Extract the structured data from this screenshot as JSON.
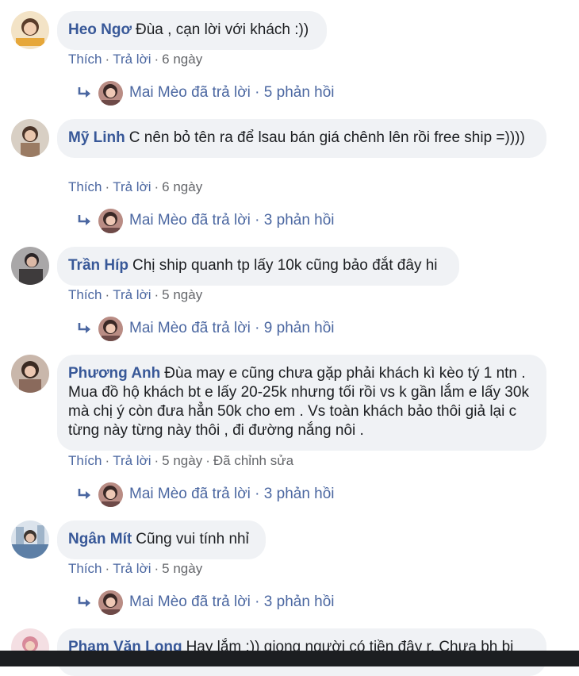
{
  "comments": [
    {
      "author": "Heo Ngơ",
      "text": "Đùa , cạn lời với khách :))",
      "like": "Thích",
      "reply": "Trả lời",
      "time": "6 ngày",
      "replies": "Mai Mèo đã trả lời · 5 phản hồi",
      "avatar_color": "#e6a73a"
    },
    {
      "author": "Mỹ Linh",
      "text": "C nên bỏ tên ra để lsau bán giá chênh lên rồi free ship =))))",
      "like": "Thích",
      "reply": "Trả lời",
      "time": "6 ngày",
      "replies": "Mai Mèo đã trả lời · 3 phản hồi",
      "avatar_color": "#9a7b63"
    },
    {
      "author": "Trần Híp",
      "text": "Chị ship quanh tp lấy 10k cũng bảo đắt đây hi",
      "like": "Thích",
      "reply": "Trả lời",
      "time": "5 ngày",
      "replies": "Mai Mèo đã trả lời · 9 phản hồi",
      "avatar_color": "#6d6a6b"
    },
    {
      "author": "Phương Anh",
      "text": "Đùa may e cũng chưa gặp phải khách kì kèo tý 1 ntn . Mua đồ hộ khách bt e lấy 20-25k nhưng tối rồi vs k gần lắm e lấy 30k mà chị ý còn đưa hẳn 50k cho em . Vs toàn khách bảo thôi giả lại c từng này từng này thôi , đi đường nắng nôi .",
      "like": "Thích",
      "reply": "Trả lời",
      "time": "5 ngày",
      "edited": "Đã chỉnh sửa",
      "replies": "Mai Mèo đã trả lời · 3 phản hồi",
      "avatar_color": "#8a6a5c"
    },
    {
      "author": "Ngân Mít",
      "text": "Cũng vui tính nhỉ",
      "like": "Thích",
      "reply": "Trả lời",
      "time": "5 ngày",
      "replies": "Mai Mèo đã trả lời · 3 phản hồi",
      "avatar_color": "#5d7fa6"
    },
    {
      "author": "Phạm Văn Long",
      "text": "Hay lắm :)) giọng người có tiền đây r. Chưa bh bị",
      "avatar_color": "#d88a9a"
    }
  ],
  "colors": {
    "bubble": "#f0f2f5",
    "author": "#385898",
    "link": "#4b67a1",
    "meta": "#65676b"
  },
  "icons": {
    "reply_arrow": "reply-arrow-icon",
    "mini_avatar": "mai-meo-avatar"
  }
}
